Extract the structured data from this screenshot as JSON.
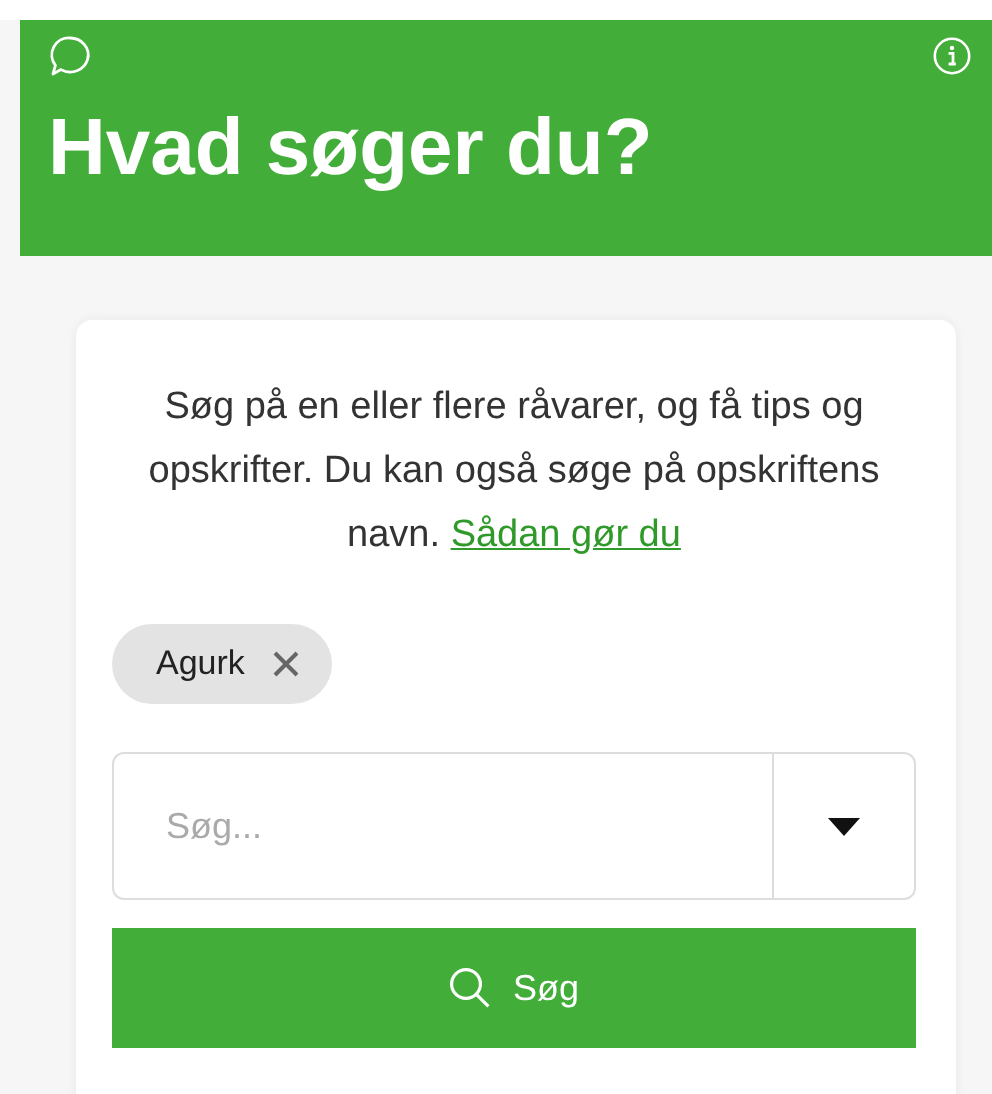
{
  "header": {
    "title": "Hvad søger du?"
  },
  "intro": {
    "text": "Søg på en eller flere råvarer, og få tips og opskrifter. Du kan også søge på opskriftens navn.",
    "link": "Sådan gør du"
  },
  "chips": [
    {
      "label": "Agurk"
    }
  ],
  "search": {
    "placeholder": "Søg..."
  },
  "search_button": {
    "label": "Søg"
  }
}
